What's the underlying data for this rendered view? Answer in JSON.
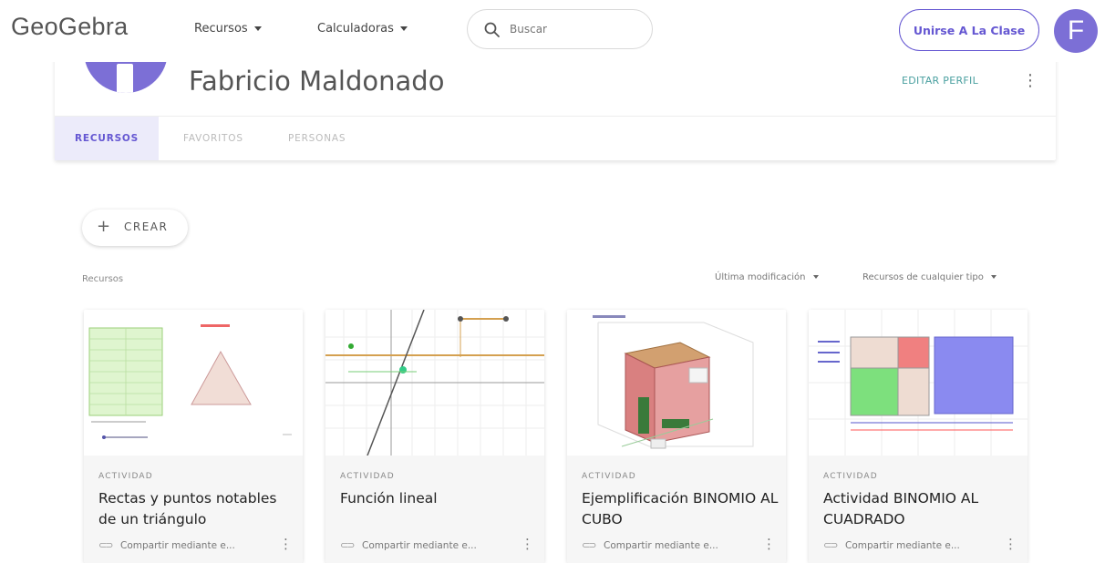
{
  "header": {
    "logo": "GeoGebra",
    "menu": [
      {
        "label": "Recursos"
      },
      {
        "label": "Calculadoras"
      }
    ],
    "search_placeholder": "Buscar",
    "join_button": "Unirse A La Clase",
    "avatar_letter": "F"
  },
  "profile": {
    "name": "Fabricio Maldonado",
    "edit_label": "EDITAR PERFIL",
    "tabs": [
      {
        "label": "RECURSOS",
        "active": true
      },
      {
        "label": "FAVORITOS",
        "active": false
      },
      {
        "label": "PERSONAS",
        "active": false
      }
    ]
  },
  "toolbar": {
    "create_label": "CREAR",
    "section_label": "Recursos",
    "sort_label": "Última modificación",
    "filter_label": "Recursos de cualquier tipo"
  },
  "cards": [
    {
      "type": "ACTIVIDAD",
      "title": "Rectas y puntos notables de un triángulo",
      "share": "Compartir mediante e..."
    },
    {
      "type": "ACTIVIDAD",
      "title": "Función lineal",
      "share": "Compartir mediante e..."
    },
    {
      "type": "ACTIVIDAD",
      "title": "Ejemplificación BINOMIO AL CUBO",
      "share": "Compartir mediante e..."
    },
    {
      "type": "ACTIVIDAD",
      "title": "Actividad BINOMIO AL CUADRADO",
      "share": "Compartir mediante e..."
    }
  ],
  "colors": {
    "brand": "#6557d2",
    "avatar": "#7c6fd6",
    "edit_link": "#4aa0a0"
  }
}
